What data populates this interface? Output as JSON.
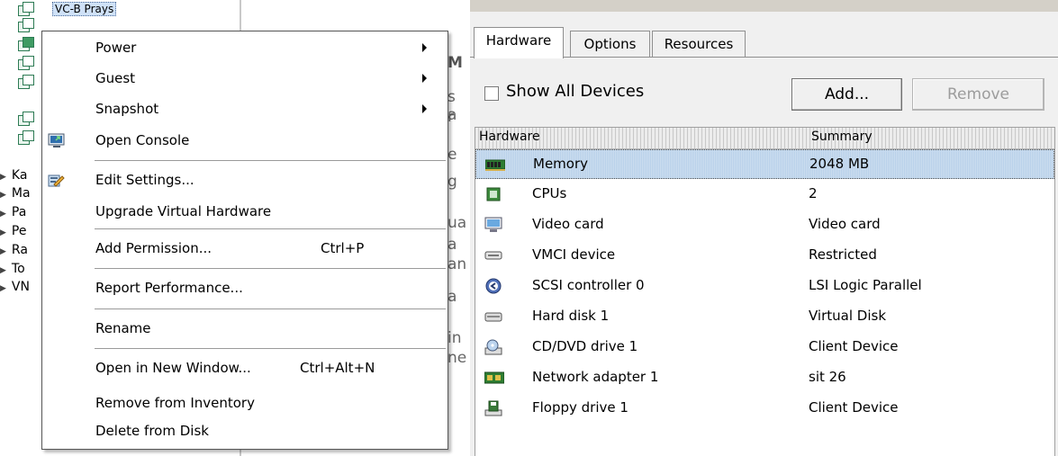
{
  "tree": {
    "selected_vm_label": "VC-B Prays",
    "nodes": [
      "Ka",
      "Ma",
      "Pa",
      "Pe",
      "Ra",
      "To",
      "VN"
    ]
  },
  "background_fragments": [
    "M",
    "s a",
    "r",
    "e",
    "g",
    "ua",
    "a",
    "an",
    "a",
    "in",
    "ne"
  ],
  "context_menu": {
    "items": [
      {
        "label": "Power",
        "shortcut": "",
        "submenu": true,
        "icon": ""
      },
      {
        "label": "Guest",
        "shortcut": "",
        "submenu": true,
        "icon": ""
      },
      {
        "label": "Snapshot",
        "shortcut": "",
        "submenu": true,
        "icon": ""
      },
      {
        "label": "Open Console",
        "shortcut": "",
        "submenu": false,
        "icon": "console-icon"
      },
      {
        "label": "Edit Settings...",
        "shortcut": "",
        "submenu": false,
        "icon": "edit-settings-icon"
      },
      {
        "label": "Upgrade Virtual Hardware",
        "shortcut": "",
        "submenu": false,
        "icon": ""
      },
      {
        "label": "Add Permission...",
        "shortcut": "Ctrl+P",
        "submenu": false,
        "icon": ""
      },
      {
        "label": "Report Performance...",
        "shortcut": "",
        "submenu": false,
        "icon": ""
      },
      {
        "label": "Rename",
        "shortcut": "",
        "submenu": false,
        "icon": ""
      },
      {
        "label": "Open in New Window...",
        "shortcut": "Ctrl+Alt+N",
        "submenu": false,
        "icon": ""
      },
      {
        "label": "Remove from Inventory",
        "shortcut": "",
        "submenu": false,
        "icon": ""
      },
      {
        "label": "Delete from Disk",
        "shortcut": "",
        "submenu": false,
        "icon": ""
      }
    ]
  },
  "properties": {
    "tabs": [
      "Hardware",
      "Options",
      "Resources"
    ],
    "active_tab": "Hardware",
    "show_all_devices_label": "Show All Devices",
    "add_button": "Add...",
    "remove_button": "Remove",
    "columns": [
      "Hardware",
      "Summary"
    ],
    "rows": [
      {
        "name": "Memory",
        "summary": "2048 MB",
        "icon": "memory-icon",
        "selected": true
      },
      {
        "name": "CPUs",
        "summary": "2",
        "icon": "cpu-icon",
        "selected": false
      },
      {
        "name": "Video card",
        "summary": "Video card",
        "icon": "monitor-icon",
        "selected": false
      },
      {
        "name": "VMCI device",
        "summary": "Restricted",
        "icon": "device-icon",
        "selected": false
      },
      {
        "name": "SCSI controller 0",
        "summary": "LSI Logic Parallel",
        "icon": "scsi-controller-icon",
        "selected": false
      },
      {
        "name": "Hard disk 1",
        "summary": "Virtual Disk",
        "icon": "hard-disk-icon",
        "selected": false
      },
      {
        "name": "CD/DVD drive 1",
        "summary": "Client Device",
        "icon": "cd-dvd-icon",
        "selected": false
      },
      {
        "name": "Network adapter 1",
        "summary": "sit 26",
        "icon": "network-adapter-icon",
        "selected": false
      },
      {
        "name": "Floppy drive 1",
        "summary": "Client Device",
        "icon": "floppy-icon",
        "selected": false
      }
    ]
  },
  "colors": {
    "selection": "#b9d1ea",
    "tree_icon": "#2c7a53"
  }
}
